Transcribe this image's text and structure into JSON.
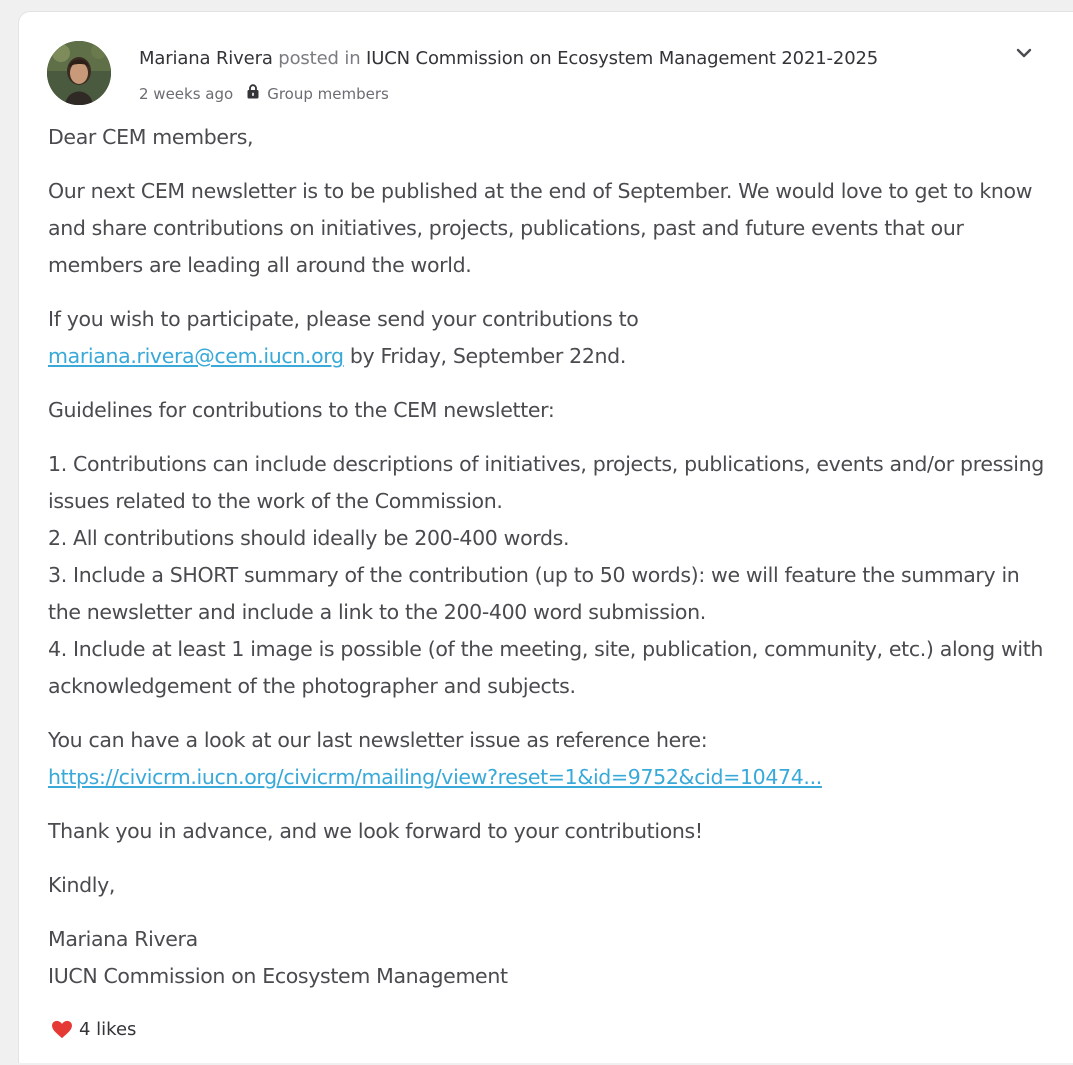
{
  "post": {
    "author": "Mariana Rivera",
    "posted_in": "posted in",
    "group": "IUCN Commission on Ecosystem Management 2021-2025",
    "time": "2 weeks ago",
    "visibility": "Group members",
    "icons": {
      "avatar": "avatar-photo",
      "visibility": "lock-icon",
      "menu": "chevron-down-icon",
      "like": "heart-icon"
    },
    "colors": {
      "link": "#38a9d8",
      "like": "#e53935"
    }
  },
  "content": {
    "greeting": "Dear CEM members,",
    "intro": "Our next CEM newsletter is to be published at the end of September. We would love to get to know and share contributions on initiatives, projects, publications, past and future events that our members are leading all around the world.",
    "participate_prefix": "If you wish to participate, please send your contributions to",
    "email": "mariana.rivera@cem.iucn.org",
    "participate_suffix": "by Friday, September 22nd.",
    "guidelines_title": "Guidelines for contributions to the CEM newsletter:",
    "guidelines": [
      "1. Contributions can include descriptions of initiatives, projects, publications, events and/or pressing issues related to the work of the Commission.",
      "2. All contributions should ideally be 200-400 words.",
      "3. Include a SHORT summary of the contribution (up to 50 words): we will feature the summary in the newsletter and include a link to the 200-400 word submission.",
      "4. Include at least 1 image is possible (of the meeting, site, publication, community, etc.) along with acknowledgement of the photographer and subjects."
    ],
    "reference_text": "You can have a look at our last newsletter issue as reference here:",
    "reference_link": "https://civicrm.iucn.org/civicrm/mailing/view?reset=1&id=9752&cid=10474...",
    "thanks": "Thank you in advance, and we look forward to your contributions!",
    "closing": "Kindly,",
    "signature_name": "Mariana Rivera",
    "signature_org": "IUCN Commission on Ecosystem Management"
  },
  "reactions": {
    "likes_label": "4 likes"
  }
}
